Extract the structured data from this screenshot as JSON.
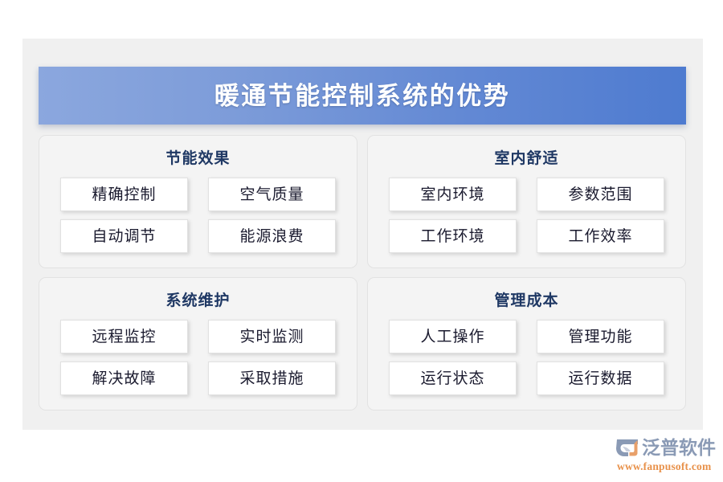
{
  "banner": {
    "title": "暖通节能控制系统的优势",
    "gradient_from": "#8ba7de",
    "gradient_to": "#4e7bd0",
    "title_color": "#ffffff"
  },
  "theme": {
    "page_background": "#ffffff",
    "panel_background": "#f0f0f0",
    "card_background": "#f4f4f4",
    "card_border": "#e2e2e2",
    "item_background": "#ffffff",
    "item_border": "#e1e1e1",
    "heading_color": "#1f3864",
    "item_text_color": "#1a1a2e"
  },
  "quadrants": [
    {
      "title": "节能效果",
      "items": [
        "精确控制",
        "空气质量",
        "自动调节",
        "能源浪费"
      ]
    },
    {
      "title": "室内舒适",
      "items": [
        "室内环境",
        "参数范围",
        "工作环境",
        "工作效率"
      ]
    },
    {
      "title": "系统维护",
      "items": [
        "远程监控",
        "实时监测",
        "解决故障",
        "采取措施"
      ]
    },
    {
      "title": "管理成本",
      "items": [
        "人工操作",
        "管理功能",
        "运行状态",
        "运行数据"
      ]
    }
  ],
  "logo": {
    "name": "泛普软件",
    "url": "www.fanpusoft.com",
    "name_color": "#8a9ab5",
    "url_color": "#e8914a",
    "mark_primary_color": "#8a9ab5",
    "mark_accent_color": "#e8914a"
  }
}
